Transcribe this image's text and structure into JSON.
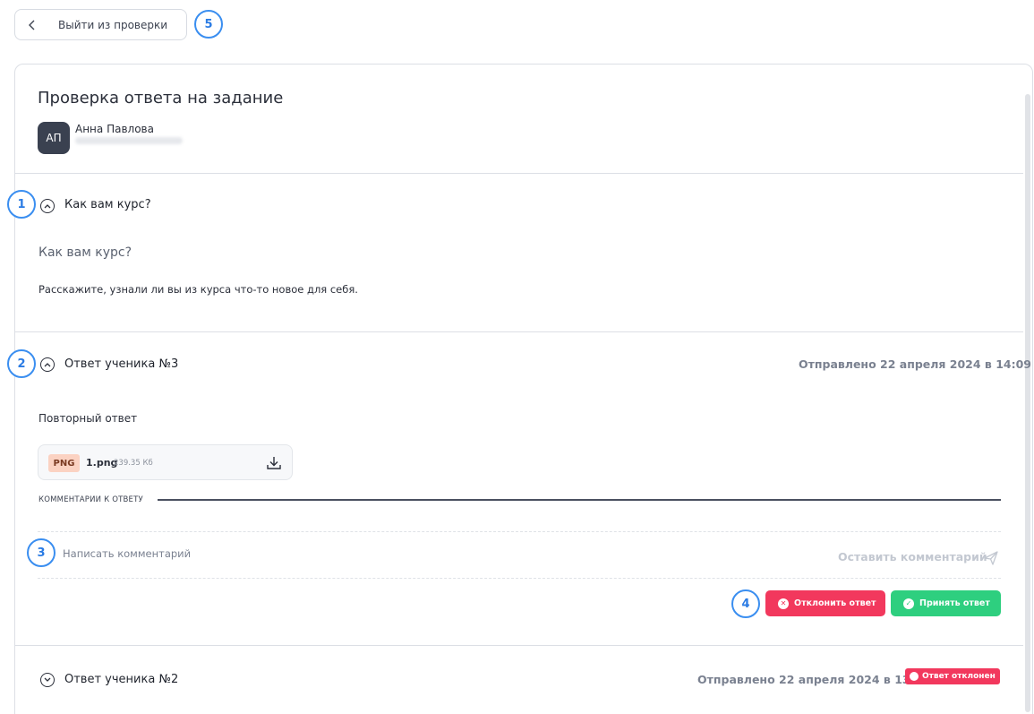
{
  "back_button": {
    "label": "Выйти из проверки"
  },
  "markers": [
    "1",
    "2",
    "3",
    "4",
    "5"
  ],
  "page": {
    "title": "Проверка ответа на задание"
  },
  "user": {
    "initials": "АП",
    "name": "Анна Павлова"
  },
  "question_section": {
    "header": "Как вам курс?",
    "title": "Как вам курс?",
    "text": "Расскажите, узнали ли вы из курса что-то новое для себя."
  },
  "answer_3": {
    "header": "Ответ ученика №3",
    "sent": "Отправлено 22 апреля 2024 в 14:09",
    "text": "Повторный ответ",
    "file": {
      "type": "PNG",
      "name": "1.png",
      "size": "239.35 Кб"
    },
    "comments_label": "КОММЕНТАРИИ К ОТВЕТУ",
    "comment_placeholder": "Написать комментарий",
    "send_label": "Оставить комментарий",
    "reject_label": "Отклонить ответ",
    "accept_label": "Принять ответ"
  },
  "answer_2": {
    "header": "Ответ ученика №2",
    "sent": "Отправлено 22 апреля 2024 в 13:52",
    "status": "Ответ отклонен"
  },
  "colors": {
    "accent": "#3a8ef0",
    "reject": "#f2385d",
    "accept": "#2ecf7f",
    "avatar": "#3a4150"
  }
}
